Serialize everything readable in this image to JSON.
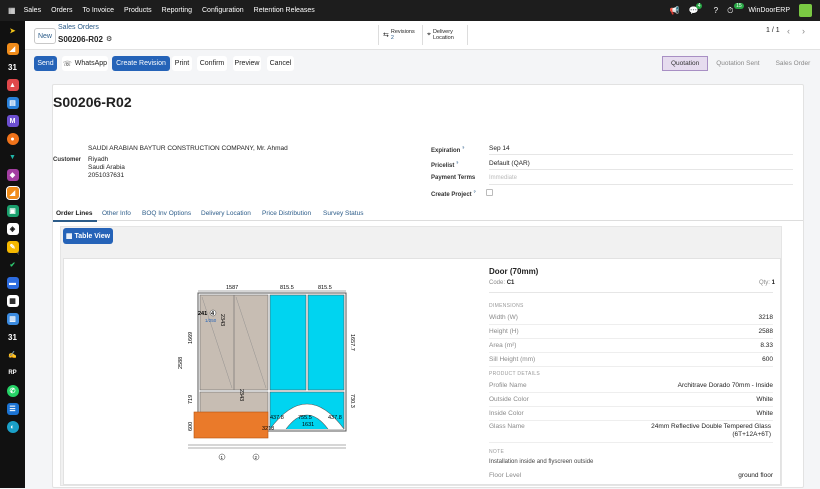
{
  "topbar": {
    "menu": [
      "Sales",
      "Orders",
      "To Invoice",
      "Products",
      "Reporting",
      "Configuration",
      "Retention Releases"
    ],
    "badge_chat": "4",
    "badge_activity": "15",
    "company": "WinDoorERP"
  },
  "breadcrumb": {
    "new_label": "New",
    "parent": "Sales Orders",
    "record": "S00206-R02",
    "revisions_label": "Revisions",
    "revisions_count": "2",
    "delivery_label": "Delivery",
    "location_label": "Location",
    "pager": "1 / 1"
  },
  "actions": {
    "send": "Send",
    "whatsapp": "WhatsApp",
    "create_revision": "Create Revision",
    "print": "Print",
    "confirm": "Confirm",
    "preview": "Preview",
    "cancel": "Cancel"
  },
  "status": [
    "Quotation",
    "Quotation Sent",
    "Sales Order"
  ],
  "form": {
    "title": "S00206-R02",
    "customer_label": "Customer",
    "customer_name": "SAUDI ARABIAN BAYTUR CONSTRUCTION COMPANY, Mr. Ahmad",
    "customer_city": "Riyadh",
    "customer_country": "Saudi Arabia",
    "customer_phone": "2051037631",
    "expiration_label": "Expiration",
    "expiration_value": "Sep 14",
    "pricelist_label": "Pricelist",
    "pricelist_value": "Default (QAR)",
    "payment_terms_label": "Payment Terms",
    "payment_terms_placeholder": "Immediate",
    "create_project_label": "Create Project",
    "help_mark": "?"
  },
  "tabs": [
    "Order Lines",
    "Other Info",
    "BOQ Inv Options",
    "Delivery Location",
    "Price Distribution",
    "Survey Status"
  ],
  "table_view_label": "Table View",
  "drawing": {
    "dims_top": [
      "1587",
      "815.5",
      "815.5"
    ],
    "dims_left": [
      "2588",
      "1669",
      "719",
      "600"
    ],
    "dims_bottom": [
      "437.8",
      "755.5",
      "437.8",
      "1631",
      "3218"
    ],
    "dims_inner": [
      "2343",
      "2343",
      "1657.7",
      "730.3"
    ],
    "marker_code": "241",
    "marker_num": "4",
    "marker_sub": "1/250",
    "circles": [
      "1",
      "2"
    ]
  },
  "product": {
    "title": "Door (70mm)",
    "code_label": "Code:",
    "code_value": "C1",
    "qty_label": "Qty:",
    "qty_value": "1",
    "dimensions_header": "DIMENSIONS",
    "dimensions": [
      {
        "label": "Width (W)",
        "value": "3218"
      },
      {
        "label": "Height (H)",
        "value": "2588"
      },
      {
        "label": "Area (m²)",
        "value": "8.33"
      },
      {
        "label": "Sill Height (mm)",
        "value": "600"
      }
    ],
    "details_header": "PRODUCT DETAILS",
    "details": [
      {
        "label": "Profile Name",
        "value": "Architrave Dorado 70mm - Inside"
      },
      {
        "label": "Outside Color",
        "value": "White"
      },
      {
        "label": "Inside Color",
        "value": "White"
      }
    ],
    "glass_label": "Glass Name",
    "glass_value_1": "24mm Reflective Double Tempered Glass",
    "glass_value_2": "(6T+12A+6T)",
    "note_header": "NOTE",
    "note_text": "Installation inside and flyscreen outside",
    "floor_label": "Floor Level",
    "floor_value": "ground floor"
  },
  "colors": {
    "primary": "#2563b8",
    "status_active": "#e6dcef",
    "glass": "#00d4f0",
    "sill": "#ea7a2a"
  }
}
